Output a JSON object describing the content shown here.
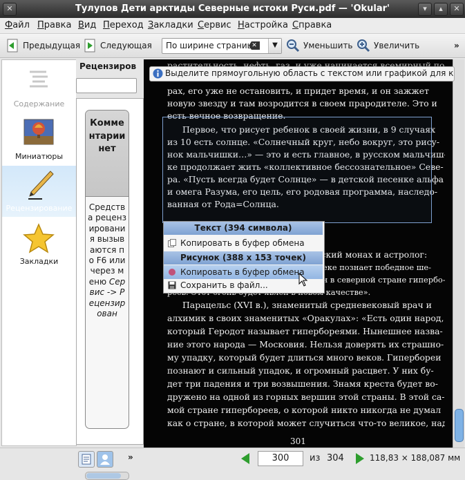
{
  "window": {
    "title": "Тулупов Дети арктиды Северные истоки Руси.pdf — 'Okular'"
  },
  "menu": [
    "Файл",
    "Правка",
    "Вид",
    "Переход",
    "Закладки",
    "Сервис",
    "Настройка",
    "Справка"
  ],
  "toolbar": {
    "prev": "Предыдущая",
    "next": "Следующая",
    "zoom_mode": "По ширине страницы",
    "zoom_out": "Уменьшить",
    "zoom_in": "Увеличить",
    "more": "»"
  },
  "sidebar": {
    "items": [
      {
        "label": "Содержание"
      },
      {
        "label": "Миниатюры"
      },
      {
        "label": "Рецензирование"
      },
      {
        "label": "Закладки"
      }
    ]
  },
  "review_panel": {
    "header": "Рецензиров",
    "note_title": "Комментарии нет",
    "note_body_plain": "Средства рецензирования вызываются по F6 или через меню",
    "note_body_italic": "Сервис -> Рецензирован"
  },
  "info_message": "Выделите прямоугольную область с текстом или графикой для к",
  "page": {
    "lines": [
      "растительность, нефть, газ, и уже начинается всемирный по-",
      "рах, его уже не остановить, и придет время, и он зажжет",
      "новую звезду и там возродится в своем прародителе. Это и",
      "есть вечное возвращение.",
      "Первое, что рисует ребенок в своей жизни, в 9 случаях",
      "из 10 есть солнце. «Солнечный круг, небо вокруг, это рису-",
      "нок мальчишки…» — это и есть главное, в русском мальчиш-",
      "ке продолжает жить «коллективное бессознательное» Севе-",
      "ра. «Пусть всегда будет Солнце» — в детской песенке альфа",
      "и омега Разума, его цель, его родовая программа, наследо-",
      "ванная от Рода=Солнца.",
      "Нострадамус (XVI в.), французский монах и астролог:",
      "«В отдаленной стране Севера в XXI веке познает победное ше-",
      "ствие. Этот огонь будет вновь обретен в северной стране гипербо-",
      "реев. Этот огонь будет явлен в новом качестве».",
      "Парацельс (XVI в.), знаменитый средневековый врач и",
      "алхимик в своих знаменитых «Оракулах»: «Есть один народ,",
      "который Геродот называет гипербореями. Нынешнее назва-",
      "ние этого народа — Московия. Нельзя доверять их страшно-",
      "му упадку, который будет длиться много веков. Гипербореи",
      "познают и сильный упадок, и огромный расцвет. У них бу-",
      "дет три падения и три возвышения. Знамя креста будет во-",
      "дружено на одной из горных вершин этой страны. В этой са-",
      "мой стране гипербореев, о которой никто никогда не думал",
      "как о стране, в которой может случиться что-то великое, над"
    ],
    "page_number_label": "301"
  },
  "popup": {
    "text_header": "Текст (394 символа)",
    "text_copy": "Копировать в буфер обмена",
    "image_header": "Рисунок (388 x 153 точек)",
    "image_copy": "Копировать в буфер обмена",
    "image_save": "Сохранить в файл..."
  },
  "bottombar": {
    "current_page": "300",
    "of_label": "из",
    "total_pages": "304",
    "page_size": "118,83 × 188,087 мм",
    "more": "»"
  },
  "colors": {
    "accent": "#7fa2d2",
    "nav_green": "#2e9e2e",
    "doc_bg": "#050505"
  }
}
